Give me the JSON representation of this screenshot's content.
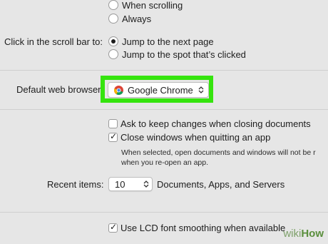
{
  "scroll_bars": {
    "options": [
      {
        "label": "When scrolling",
        "selected": false
      },
      {
        "label": "Always",
        "selected": false
      }
    ]
  },
  "click_scroll_bar": {
    "label": "Click in the scroll bar to:",
    "options": [
      {
        "label": "Jump to the next page",
        "selected": true
      },
      {
        "label": "Jump to the spot that’s clicked",
        "selected": false
      }
    ]
  },
  "default_browser": {
    "label": "Default web browser",
    "value": "Google Chrome",
    "highlight_color": "#35e40e"
  },
  "documents": {
    "ask_keep_changes": {
      "label": "Ask to keep changes when closing documents",
      "checked": false
    },
    "close_windows": {
      "label": "Close windows when quitting an app",
      "checked": true
    },
    "help_line1": "When selected, open documents and windows will not be r",
    "help_line2": "when you re-open an app."
  },
  "recent_items": {
    "label": "Recent items:",
    "value": "10",
    "suffix": "Documents, Apps, and Servers"
  },
  "lcd": {
    "label": "Use LCD font smoothing when available",
    "checked": true
  },
  "watermark": {
    "wiki": "wiki",
    "how": "How"
  }
}
